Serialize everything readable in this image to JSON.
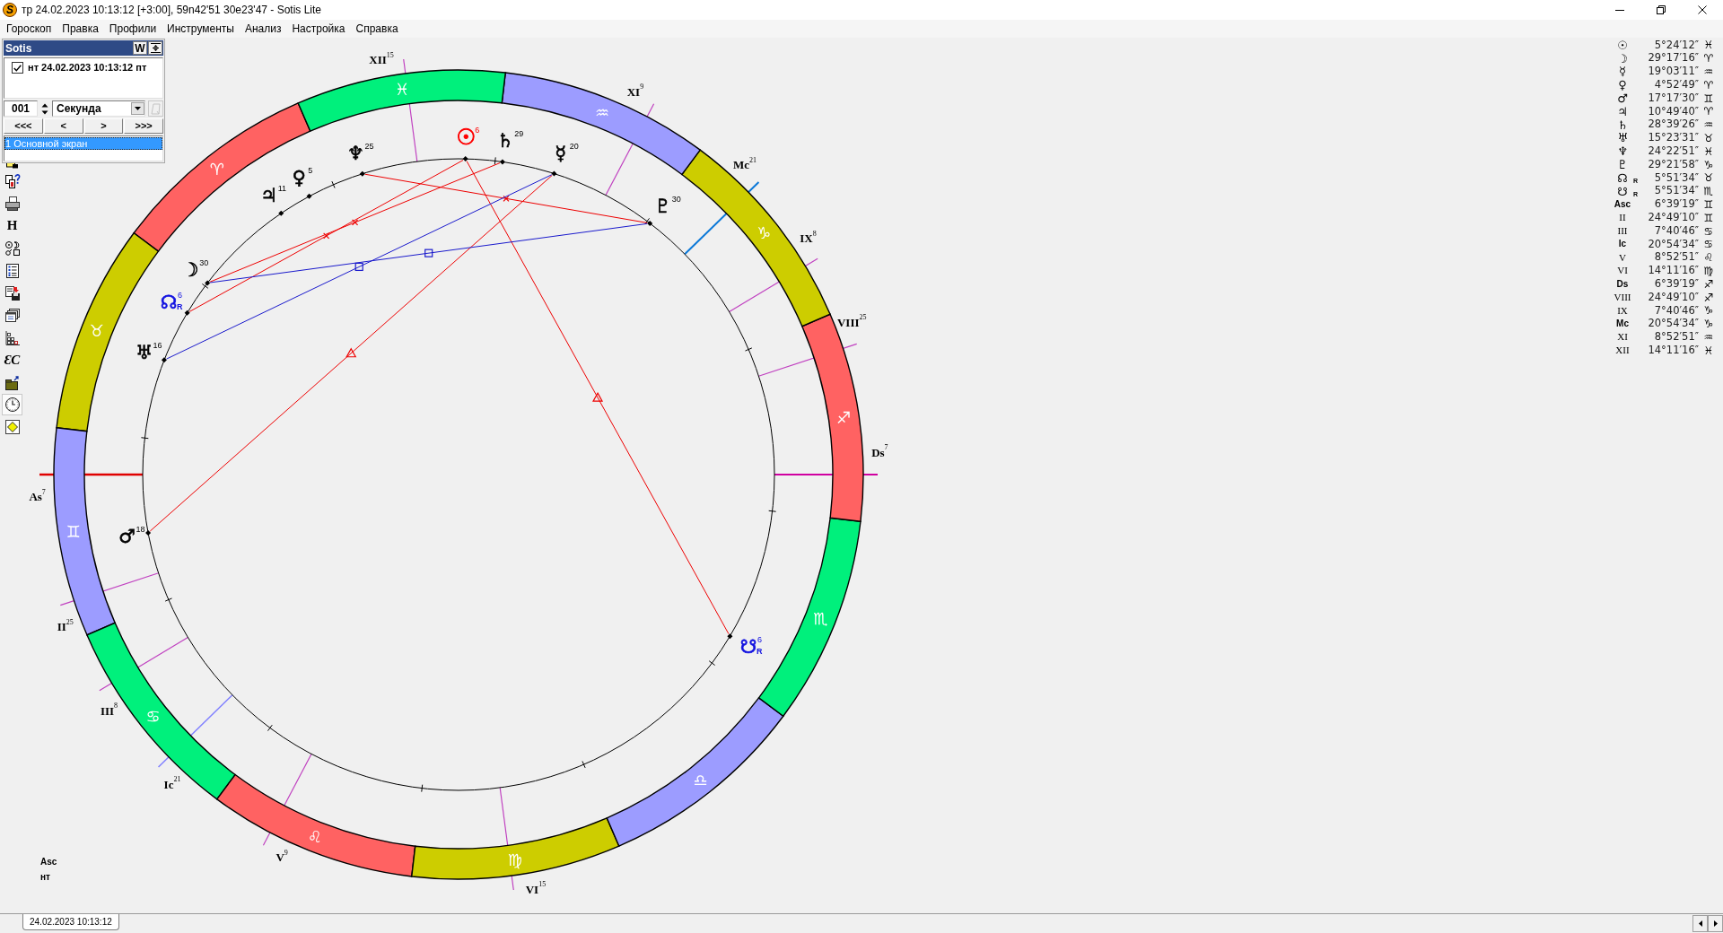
{
  "window": {
    "logo": "S",
    "title": "тр 24.02.2023 10:13:12 [+3:00], 59n42'51 30e23'47 - Sotis Lite"
  },
  "menu": [
    "Гороскоп",
    "Правка",
    "Профили",
    "Инструменты",
    "Анализ",
    "Настройка",
    "Справка"
  ],
  "toolbar": [
    {
      "kind": "icon",
      "selected": false
    },
    {
      "kind": "icon",
      "selected": false
    },
    {
      "kind": "icon",
      "selected": false
    },
    {
      "kind": "letter",
      "text": "H",
      "selected": false
    },
    {
      "kind": "icon",
      "selected": false
    },
    {
      "kind": "icon",
      "selected": false
    },
    {
      "kind": "icon",
      "selected": false
    },
    {
      "kind": "icon",
      "selected": false
    },
    {
      "kind": "icon",
      "selected": false
    },
    {
      "kind": "letter",
      "text": "ƐC",
      "selected": false
    },
    {
      "kind": "icon",
      "selected": false
    },
    {
      "kind": "icon",
      "selected": true
    },
    {
      "kind": "icon",
      "selected": false
    }
  ],
  "panel": {
    "title": "Sotis",
    "title_buttons": [
      "W"
    ],
    "entries": [
      {
        "label": "нт 24.02.2023 10:13:12 пт",
        "checked": true
      }
    ],
    "step": {
      "count": "001",
      "unit": "Секунда"
    },
    "extra_button": {
      "disabled": true
    },
    "nav_buttons": [
      "<<<",
      "<",
      ">",
      ">>>"
    ],
    "screens": [
      {
        "label": "1 Основной экран",
        "selected": true
      }
    ]
  },
  "chart": {
    "signs": [
      {
        "glyph": "♈",
        "color": "#ff6262"
      },
      {
        "glyph": "♉",
        "color": "#cdcd00"
      },
      {
        "glyph": "♊",
        "color": "#9c9cff"
      },
      {
        "glyph": "♋",
        "color": "#00f07c"
      },
      {
        "glyph": "♌",
        "color": "#ff6262"
      },
      {
        "glyph": "♍",
        "color": "#cdcd00"
      },
      {
        "glyph": "♎",
        "color": "#9c9cff"
      },
      {
        "glyph": "♏",
        "color": "#00f07c"
      },
      {
        "glyph": "♐",
        "color": "#ff6262"
      },
      {
        "glyph": "♑",
        "color": "#cdcd00"
      },
      {
        "glyph": "♒",
        "color": "#9c9cff"
      },
      {
        "glyph": "♓",
        "color": "#00f07c"
      }
    ],
    "cusps": [
      {
        "label": "As",
        "degree": "7",
        "color": "#e00000"
      },
      {
        "label": "II",
        "degree": "25",
        "color": "#c040c0"
      },
      {
        "label": "III",
        "degree": "8",
        "color": "#c040c0"
      },
      {
        "label": "Ic",
        "degree": "21",
        "color": "#8080ff"
      },
      {
        "label": "V",
        "degree": "9",
        "color": "#c040c0"
      },
      {
        "label": "VI",
        "degree": "15",
        "color": "#c040c0"
      },
      {
        "label": "Ds",
        "degree": "7",
        "color": "#d000a0"
      },
      {
        "label": "VIII",
        "degree": "25",
        "color": "#c040c0"
      },
      {
        "label": "IX",
        "degree": "8",
        "color": "#c040c0"
      },
      {
        "label": "Mc",
        "degree": "21",
        "color": "#0a78d8"
      },
      {
        "label": "XI",
        "degree": "9",
        "color": "#c040c0"
      },
      {
        "label": "XII",
        "degree": "15",
        "color": "#c040c0"
      }
    ],
    "planets": [
      {
        "glyph": "☉",
        "degree": "6",
        "color": "#ff0000"
      },
      {
        "glyph": "☽",
        "degree": "30",
        "color": "#000000"
      },
      {
        "glyph": "☿",
        "degree": "20",
        "color": "#000000"
      },
      {
        "glyph": "♀",
        "degree": "5",
        "color": "#000000"
      },
      {
        "glyph": "♂",
        "degree": "18",
        "color": "#000000"
      },
      {
        "glyph": "♃",
        "degree": "11",
        "color": "#000000"
      },
      {
        "glyph": "♄",
        "degree": "29",
        "color": "#000000"
      },
      {
        "glyph": "♅",
        "degree": "16",
        "color": "#000000"
      },
      {
        "glyph": "♆",
        "degree": "25",
        "color": "#000000"
      },
      {
        "glyph": "♇",
        "degree": "30",
        "color": "#000000"
      },
      {
        "glyph": "☊",
        "degree": "6",
        "retro_mark": "R",
        "color": "#1010e0"
      },
      {
        "glyph": "☋",
        "degree": "6",
        "retro_mark": "R",
        "color": "#1010e0"
      }
    ],
    "footer": [
      "Asc",
      "нт"
    ]
  },
  "positions": [
    {
      "kind": "planet",
      "symbol": "☉",
      "value": "5°24′12″",
      "sign": "♓"
    },
    {
      "kind": "planet",
      "symbol": "☽",
      "value": "29°17′16″",
      "sign": "♈"
    },
    {
      "kind": "planet",
      "symbol": "☿",
      "value": "19°03′11″",
      "sign": "♒"
    },
    {
      "kind": "planet",
      "symbol": "♀",
      "value": "4°52′49″",
      "sign": "♈"
    },
    {
      "kind": "planet",
      "symbol": "♂",
      "value": "17°17′30″",
      "sign": "♊"
    },
    {
      "kind": "planet",
      "symbol": "♃",
      "value": "10°49′40″",
      "sign": "♈"
    },
    {
      "kind": "planet",
      "symbol": "♄",
      "value": "28°39′26″",
      "sign": "♒"
    },
    {
      "kind": "planet",
      "symbol": "♅",
      "value": "15°23′31″",
      "sign": "♉"
    },
    {
      "kind": "planet",
      "symbol": "♆",
      "value": "24°22′51″",
      "sign": "♓"
    },
    {
      "kind": "planet",
      "symbol": "♇",
      "value": "29°21′58″",
      "sign": "♑"
    },
    {
      "kind": "planet",
      "symbol": "☊",
      "retro_mark": "R",
      "value": "5°51′34″",
      "sign": "♉"
    },
    {
      "kind": "planet",
      "symbol": "☋",
      "retro_mark": "R",
      "value": "5°51′34″",
      "sign": "♏"
    },
    {
      "kind": "angle",
      "symbol": "Asc",
      "value": "6°39′19″",
      "sign": "♊"
    },
    {
      "kind": "cusp",
      "symbol": "II",
      "value": "24°49′10″",
      "sign": "♊"
    },
    {
      "kind": "cusp",
      "symbol": "III",
      "value": "7°40′46″",
      "sign": "♋"
    },
    {
      "kind": "angle",
      "symbol": "Ic",
      "value": "20°54′34″",
      "sign": "♋"
    },
    {
      "kind": "cusp",
      "symbol": "V",
      "value": "8°52′51″",
      "sign": "♌"
    },
    {
      "kind": "cusp",
      "symbol": "VI",
      "value": "14°11′16″",
      "sign": "♍"
    },
    {
      "kind": "angle",
      "symbol": "Ds",
      "value": "6°39′19″",
      "sign": "♐"
    },
    {
      "kind": "cusp",
      "symbol": "VIII",
      "value": "24°49′10″",
      "sign": "♐"
    },
    {
      "kind": "cusp",
      "symbol": "IX",
      "value": "7°40′46″",
      "sign": "♑"
    },
    {
      "kind": "angle",
      "symbol": "Mc",
      "value": "20°54′34″",
      "sign": "♑"
    },
    {
      "kind": "cusp",
      "symbol": "XI",
      "value": "8°52′51″",
      "sign": "♒"
    },
    {
      "kind": "cusp",
      "symbol": "XII",
      "value": "14°11′16″",
      "sign": "♓"
    }
  ],
  "tabs": [
    {
      "label": "24.02.2023 10:13:12",
      "selected": true
    }
  ]
}
